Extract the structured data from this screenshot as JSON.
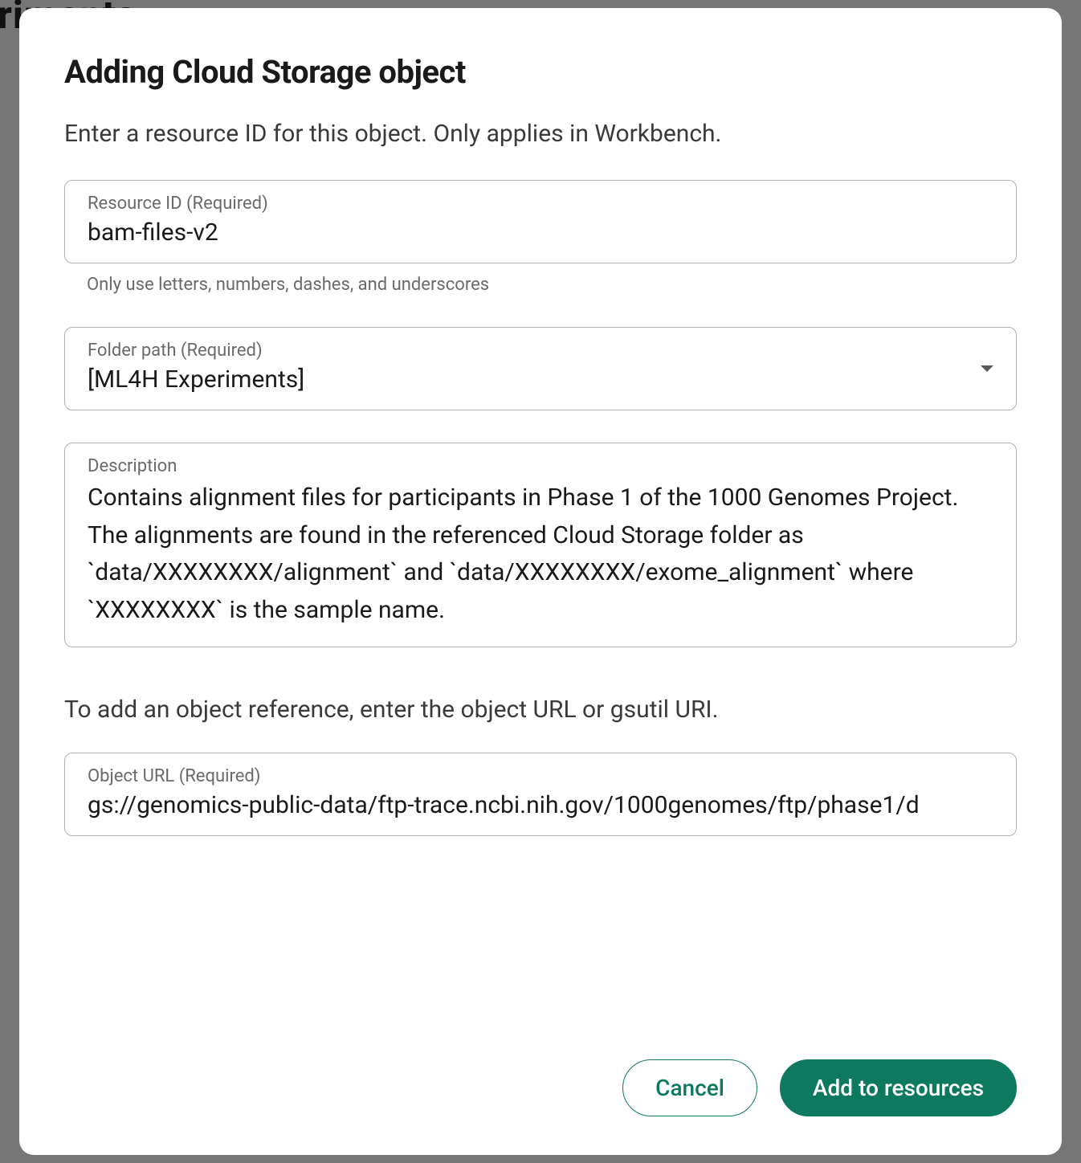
{
  "background": {
    "partial_heading": "eriments"
  },
  "modal": {
    "title": "Adding Cloud Storage object",
    "subtitle": "Enter a resource ID for this object. Only applies in Workbench.",
    "resource_id": {
      "label": "Resource ID (Required)",
      "value": "bam-files-v2",
      "helper": "Only use letters, numbers, dashes, and underscores"
    },
    "folder_path": {
      "label": "Folder path (Required)",
      "value": "[ML4H Experiments]"
    },
    "description": {
      "label": "Description",
      "value": "Contains alignment files for participants in Phase 1 of the 1000 Genomes Project. The alignments are found in the referenced Cloud Storage folder as `data/XXXXXXXX/alignment` and `data/XXXXXXXX/exome_alignment` where `XXXXXXXX` is the sample name."
    },
    "object_ref_text": "To add an object reference, enter the object URL or gsutil URI.",
    "object_url": {
      "label": "Object URL (Required)",
      "value": "gs://genomics-public-data/ftp-trace.ncbi.nih.gov/1000genomes/ftp/phase1/d"
    },
    "actions": {
      "cancel": "Cancel",
      "submit": "Add to resources"
    }
  }
}
